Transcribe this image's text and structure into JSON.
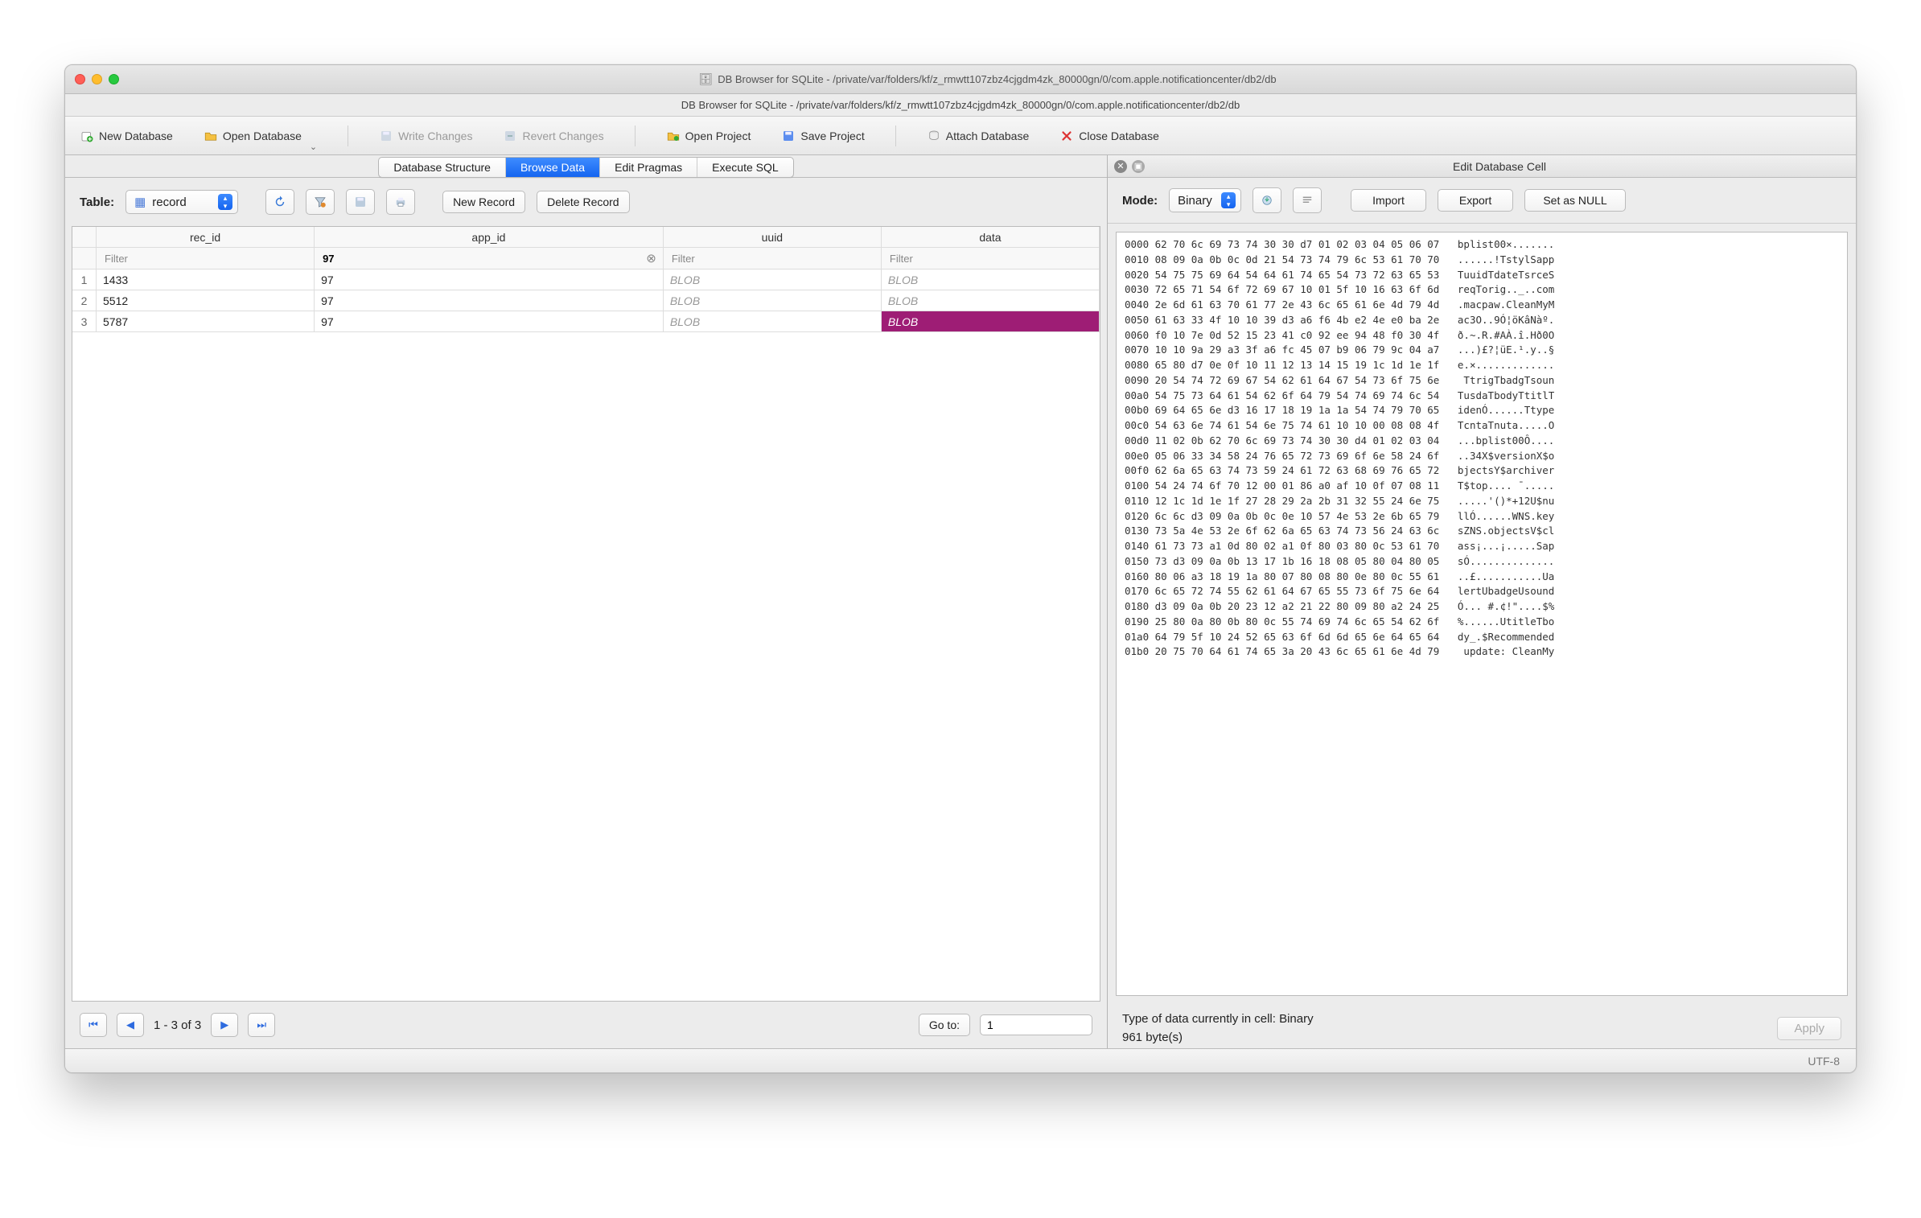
{
  "window": {
    "app_name": "DB Browser for SQLite",
    "title": "DB Browser for SQLite - /private/var/folders/kf/z_rmwtt107zbz4cjgdm4zk_80000gn/0/com.apple.notificationcenter/db2/db",
    "subtitle": "DB Browser for SQLite - /private/var/folders/kf/z_rmwtt107zbz4cjgdm4zk_80000gn/0/com.apple.notificationcenter/db2/db"
  },
  "toolbar": {
    "new_db": "New Database",
    "open_db": "Open Database",
    "write_changes": "Write Changes",
    "revert_changes": "Revert Changes",
    "open_project": "Open Project",
    "save_project": "Save Project",
    "attach_db": "Attach Database",
    "close_db": "Close Database"
  },
  "tabs": {
    "structure": "Database Structure",
    "browse": "Browse Data",
    "pragmas": "Edit Pragmas",
    "sql": "Execute SQL",
    "active": "browse"
  },
  "browse": {
    "table_label": "Table:",
    "table_selected": "record",
    "new_record": "New Record",
    "delete_record": "Delete Record",
    "columns": [
      "rec_id",
      "app_id",
      "uuid",
      "data"
    ],
    "filters": {
      "rec_id": "",
      "app_id": "97",
      "uuid": "",
      "data": ""
    },
    "filter_placeholder": "Filter",
    "rows": [
      {
        "n": "1",
        "rec_id": "1433",
        "app_id": "97",
        "uuid": "BLOB",
        "data": "BLOB",
        "selected_cell": null
      },
      {
        "n": "2",
        "rec_id": "5512",
        "app_id": "97",
        "uuid": "BLOB",
        "data": "BLOB",
        "selected_cell": null
      },
      {
        "n": "3",
        "rec_id": "5787",
        "app_id": "97",
        "uuid": "BLOB",
        "data": "BLOB",
        "selected_cell": "data"
      }
    ],
    "pager": {
      "range": "1 - 3 of 3",
      "goto_label": "Go to:",
      "goto_value": "1"
    }
  },
  "cell_editor": {
    "title": "Edit Database Cell",
    "mode_label": "Mode:",
    "mode": "Binary",
    "import": "Import",
    "export": "Export",
    "set_null": "Set as NULL",
    "type_line": "Type of data currently in cell: Binary",
    "size_line": "961 byte(s)",
    "apply": "Apply",
    "hex": "0000 62 70 6c 69 73 74 30 30 d7 01 02 03 04 05 06 07   bplist00×.......\n0010 08 09 0a 0b 0c 0d 21 54 73 74 79 6c 53 61 70 70   ......!TstylSapp\n0020 54 75 75 69 64 54 64 61 74 65 54 73 72 63 65 53   TuuidTdateTsrceS\n0030 72 65 71 54 6f 72 69 67 10 01 5f 10 16 63 6f 6d   reqTorig.._..com\n0040 2e 6d 61 63 70 61 77 2e 43 6c 65 61 6e 4d 79 4d   .macpaw.CleanMyM\n0050 61 63 33 4f 10 10 39 d3 a6 f6 4b e2 4e e0 ba 2e   ac3O..9Ó¦öKâNàº.\n0060 f0 10 7e 0d 52 15 23 41 c0 92 ee 94 48 f0 30 4f   ð.~.R.#AÀ.î.Hð0O\n0070 10 10 9a 29 a3 3f a6 fc 45 07 b9 06 79 9c 04 a7   ...)£?¦üE.¹.y..§\n0080 65 80 d7 0e 0f 10 11 12 13 14 15 19 1c 1d 1e 1f   e.×.............\n0090 20 54 74 72 69 67 54 62 61 64 67 54 73 6f 75 6e    TtrigTbadgTsoun\n00a0 54 75 73 64 61 54 62 6f 64 79 54 74 69 74 6c 54   TusdaTbodyTtitlT\n00b0 69 64 65 6e d3 16 17 18 19 1a 1a 54 74 79 70 65   idenÓ......Ttype\n00c0 54 63 6e 74 61 54 6e 75 74 61 10 10 00 08 08 4f   TcntaTnuta.....O\n00d0 11 02 0b 62 70 6c 69 73 74 30 30 d4 01 02 03 04   ...bplist00Ô....\n00e0 05 06 33 34 58 24 76 65 72 73 69 6f 6e 58 24 6f   ..34X$versionX$o\n00f0 62 6a 65 63 74 73 59 24 61 72 63 68 69 76 65 72   bjectsY$archiver\n0100 54 24 74 6f 70 12 00 01 86 a0 af 10 0f 07 08 11   T$top.... ¯.....\n0110 12 1c 1d 1e 1f 27 28 29 2a 2b 31 32 55 24 6e 75   .....'()*+12U$nu\n0120 6c 6c d3 09 0a 0b 0c 0e 10 57 4e 53 2e 6b 65 79   llÓ......WNS.key\n0130 73 5a 4e 53 2e 6f 62 6a 65 63 74 73 56 24 63 6c   sZNS.objectsV$cl\n0140 61 73 73 a1 0d 80 02 a1 0f 80 03 80 0c 53 61 70   ass¡...¡.....Sap\n0150 73 d3 09 0a 0b 13 17 1b 16 18 08 05 80 04 80 05   sÓ..............\n0160 80 06 a3 18 19 1a 80 07 80 08 80 0e 80 0c 55 61   ..£...........Ua\n0170 6c 65 72 74 55 62 61 64 67 65 55 73 6f 75 6e 64   lertUbadgeUsound\n0180 d3 09 0a 0b 20 23 12 a2 21 22 80 09 80 a2 24 25   Ó... #.¢!\"....$%\n0190 25 80 0a 80 0b 80 0c 55 74 69 74 6c 65 54 62 6f   %......UtitleTbo\n01a0 64 79 5f 10 24 52 65 63 6f 6d 6d 65 6e 64 65 64   dy_.$Recommended\n01b0 20 75 70 64 61 74 65 3a 20 43 6c 65 61 6e 4d 79    update: CleanMy"
  },
  "statusbar": {
    "encoding": "UTF-8"
  }
}
